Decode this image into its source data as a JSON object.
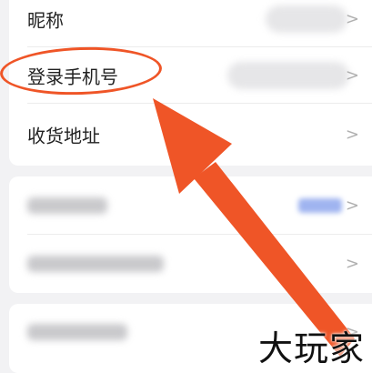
{
  "settings": {
    "rows": [
      {
        "label": "昵称"
      },
      {
        "label": "登录手机号"
      },
      {
        "label": "收货地址"
      }
    ]
  },
  "annotation": {
    "accent_color": "#ef5527",
    "circle_target": "登录手机号"
  },
  "watermark": {
    "text": "大玩家"
  },
  "icons": {
    "chevron": "chevron-right-icon"
  },
  "colors": {
    "background": "#f2f2f4",
    "card": "#ffffff",
    "arrow": "#ef5527"
  }
}
